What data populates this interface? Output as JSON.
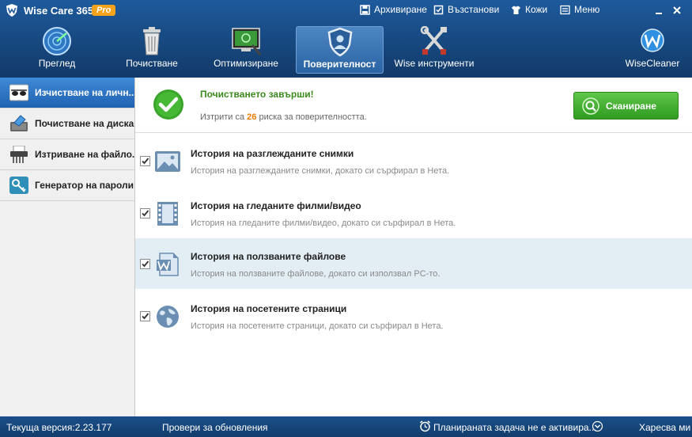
{
  "app": {
    "title": "Wise Care 365",
    "badge": "Pro"
  },
  "top_menu": {
    "backup": "Архивиране",
    "restore": "Възстанови",
    "skins": "Кожи",
    "menu": "Меню"
  },
  "nav": {
    "tabs": [
      {
        "label": "Преглед"
      },
      {
        "label": "Почистване"
      },
      {
        "label": "Оптимизиране"
      },
      {
        "label": "Поверителност"
      },
      {
        "label": "Wise инструменти"
      }
    ],
    "brand": "WiseCleaner"
  },
  "sidebar": {
    "items": [
      {
        "label": "Изчистване на личн..."
      },
      {
        "label": "Почистване на диска"
      },
      {
        "label": "Изтриване на файло..."
      },
      {
        "label": "Генератор на пароли"
      }
    ]
  },
  "summary": {
    "title": "Почистването завърши!",
    "sub_prefix": "Изтрити са",
    "count": "26",
    "sub_suffix": "риска за поверителността.",
    "scan_button": "Сканиране"
  },
  "items": [
    {
      "title": "История на разглежданите снимки",
      "desc": "История на разглежданите снимки, докато си сърфирал в Нета.",
      "checked": true
    },
    {
      "title": "История на гледаните филми/видео",
      "desc": "История на гледаните филми/видео, докато си сърфирал в Нета.",
      "checked": true
    },
    {
      "title": "История на ползваните файлове",
      "desc": "История на ползваните файлове, докато си използвал PC-то.",
      "checked": true
    },
    {
      "title": "История на посетените страници",
      "desc": "История на посетените страници, докато си сърфирал в Нета.",
      "checked": true
    }
  ],
  "status": {
    "version": "Текуща версия:2.23.177",
    "update": "Провери за обновления",
    "schedule": "Планираната задача не е активира...",
    "like": "Харесва ми"
  },
  "colors": {
    "accent": "#1f62b3",
    "success": "#3b8a1e",
    "count": "#e87a00"
  }
}
